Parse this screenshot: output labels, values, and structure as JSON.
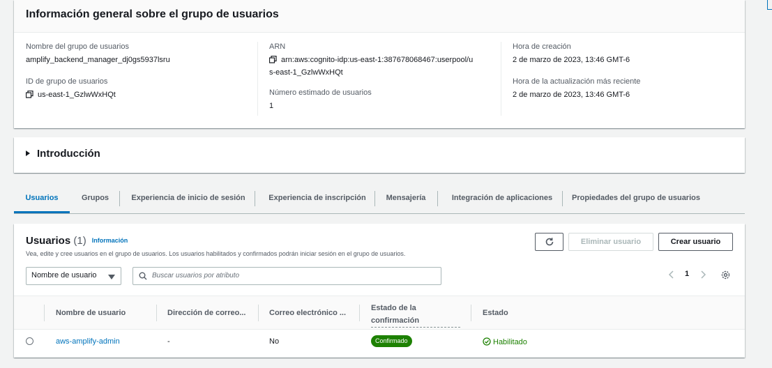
{
  "overview": {
    "title": "Información general sobre el grupo de usuarios",
    "pool_name_label": "Nombre del grupo de usuarios",
    "pool_name_value": "amplify_backend_manager_dj0gs5937lsru",
    "pool_id_label": "ID de grupo de usuarios",
    "pool_id_value": "us-east-1_GzlwWxHQt",
    "arn_label": "ARN",
    "arn_value_line1": "arn:aws:cognito-idp:us-east-1:387678068467:userpool/u",
    "arn_value_line2": "s-east-1_GzlwWxHQt",
    "est_users_label": "Número estimado de usuarios",
    "est_users_value": "1",
    "created_label": "Hora de creación",
    "created_value": "2 de marzo de 2023, 13:46 GMT-6",
    "updated_label": "Hora de la actualización más reciente",
    "updated_value": "2 de marzo de 2023, 13:46 GMT-6"
  },
  "intro": {
    "title": "Introducción"
  },
  "tabs": [
    {
      "label": "Usuarios",
      "active": true
    },
    {
      "label": "Grupos"
    },
    {
      "label": "Experiencia de inicio de sesión"
    },
    {
      "label": "Experiencia de inscripción"
    },
    {
      "label": "Mensajería"
    },
    {
      "label": "Integración de aplicaciones"
    },
    {
      "label": "Propiedades del grupo de usuarios"
    }
  ],
  "users": {
    "title": "Usuarios",
    "count": "(1)",
    "info_link": "Información",
    "description": "Vea, edite y cree usuarios en el grupo de usuarios. Los usuarios habilitados y confirmados podrán iniciar sesión en el grupo de usuarios.",
    "delete_button": "Eliminar usuario",
    "create_button": "Crear usuario",
    "filter_select": "Nombre de usuario",
    "search_placeholder": "Buscar usuarios por atributo",
    "page_number": "1",
    "columns": [
      "Nombre de usuario",
      "Dirección de correo...",
      "Correo electrónico ...",
      "Estado de la",
      "confirmación",
      "Estado"
    ],
    "rows": [
      {
        "username": "aws-amplify-admin",
        "email": "-",
        "email_verified": "No",
        "confirmation": "Confirmado",
        "status": "Habilitado"
      }
    ]
  },
  "colors": {
    "link": "#0073bb",
    "success": "#1d8102"
  }
}
